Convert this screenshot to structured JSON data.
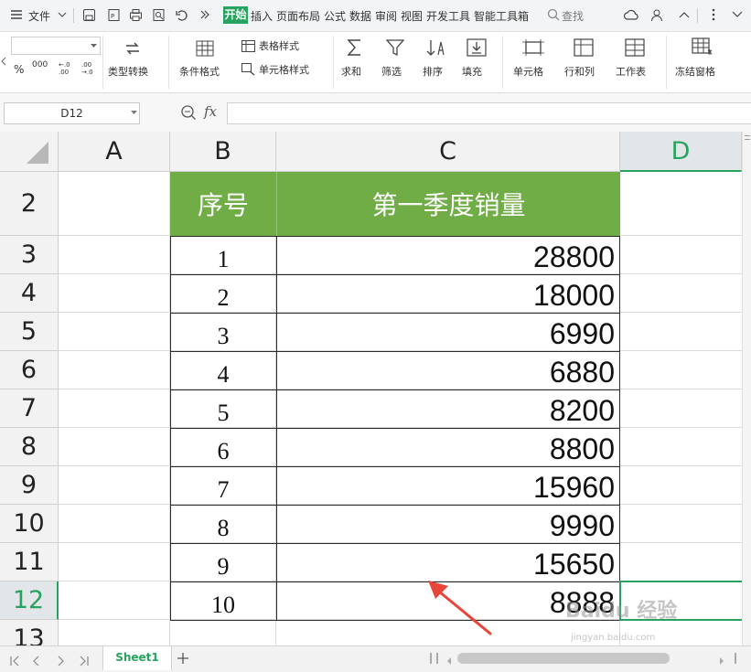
{
  "menubar": {
    "file": "文件",
    "tabs": [
      "开始",
      "插入",
      "页面布局",
      "公式",
      "数据",
      "审阅",
      "视图",
      "开发工具",
      "智能工具箱"
    ],
    "search": "查找"
  },
  "ribbon": {
    "type_convert": "类型转换",
    "cond_format": "条件格式",
    "table_style": "表格样式",
    "cell_style": "单元格样式",
    "sum": "求和",
    "filter": "筛选",
    "sort": "排序",
    "fill": "填充",
    "cell": "单元格",
    "rowcol": "行和列",
    "worksheet": "工作表",
    "freeze": "冻结窗格",
    "percent": "%",
    "thousands": "000"
  },
  "formula": {
    "namebox": "D12",
    "fx": "fx"
  },
  "columns": [
    "A",
    "B",
    "C",
    "D"
  ],
  "rows": [
    "2",
    "3",
    "4",
    "5",
    "6",
    "7",
    "8",
    "9",
    "10",
    "11",
    "12",
    "13"
  ],
  "table": {
    "header": [
      "序号",
      "第一季度销量"
    ],
    "rows": [
      [
        "1",
        "28800"
      ],
      [
        "2",
        "18000"
      ],
      [
        "3",
        "6990"
      ],
      [
        "4",
        "6880"
      ],
      [
        "5",
        "8200"
      ],
      [
        "6",
        "8800"
      ],
      [
        "7",
        "15960"
      ],
      [
        "8",
        "9990"
      ],
      [
        "9",
        "15650"
      ],
      [
        "10",
        "8888"
      ]
    ]
  },
  "colors": {
    "header_fill": "#70ad47",
    "accent": "#27a35f",
    "arrow": "#e8463a"
  },
  "status": {
    "sheet": "Sheet1"
  },
  "watermark": {
    "text": "Baidu 经验",
    "sub": "jingyan.baidu.com"
  }
}
